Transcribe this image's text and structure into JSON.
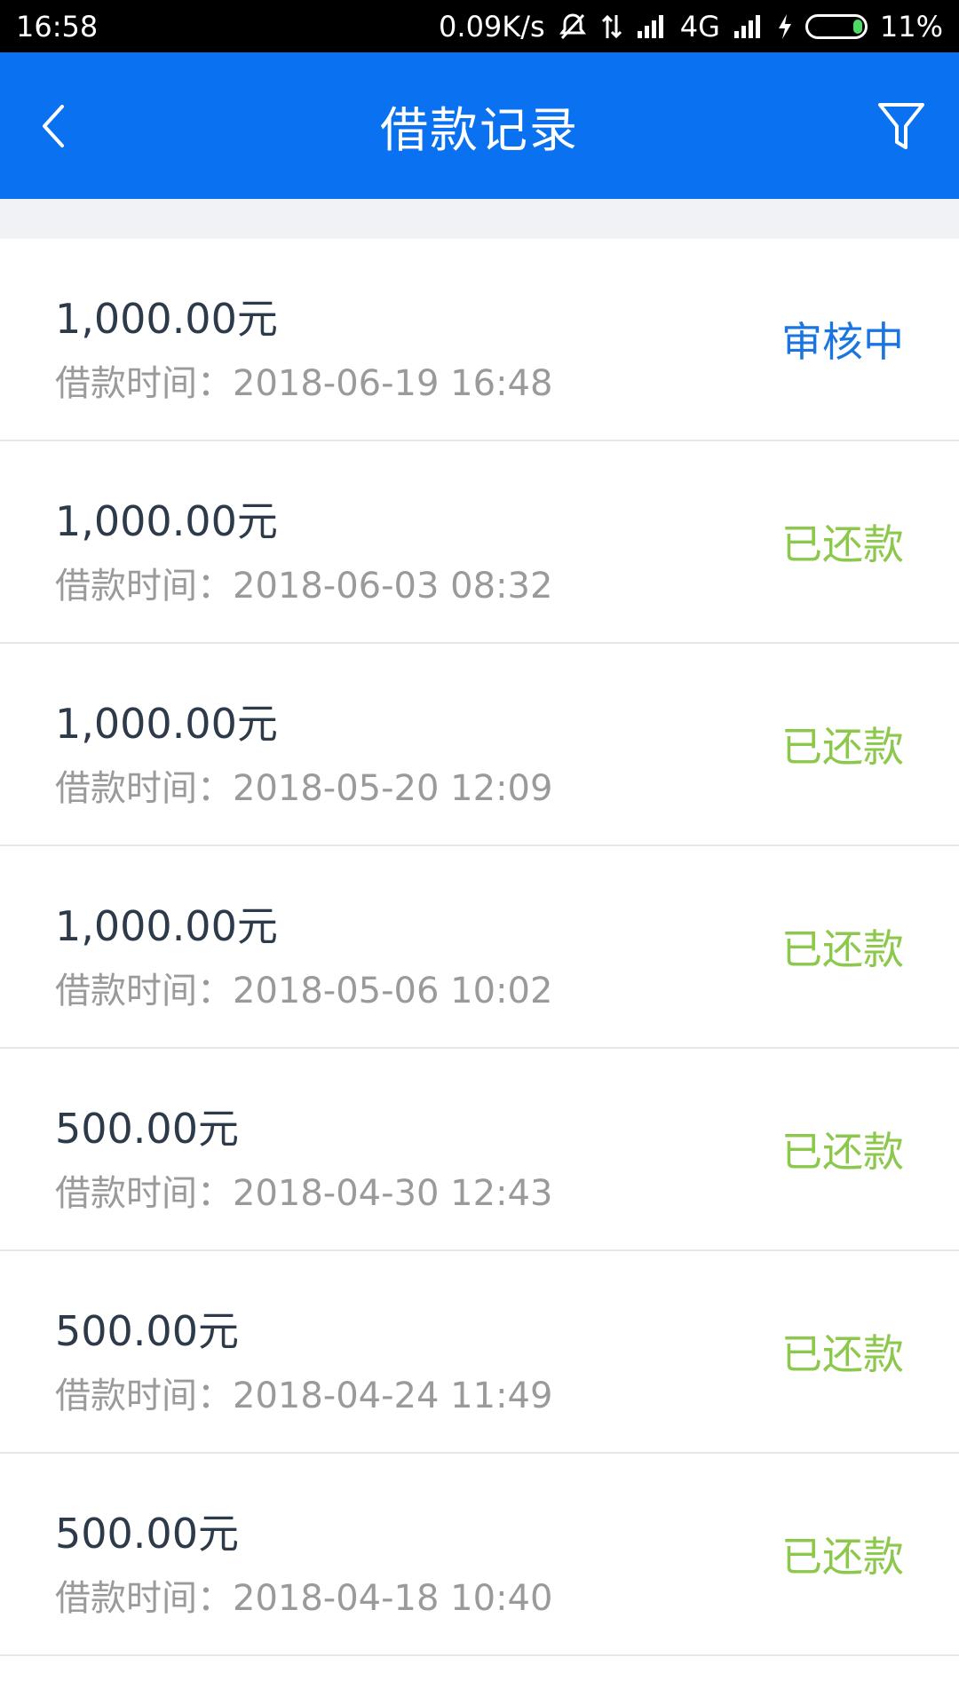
{
  "statusbar": {
    "time": "16:58",
    "speed": "0.09K/s",
    "network": "4G",
    "battery": "11%"
  },
  "header": {
    "title": "借款记录",
    "back_icon": "chevron-left-icon",
    "filter_icon": "filter-icon"
  },
  "colors": {
    "primary": "#0a72f0",
    "reviewing": "#1a75e0",
    "repaid": "#8cc84b"
  },
  "records": [
    {
      "amount": "1,000.00元",
      "time": "借款时间：2018-06-19 16:48",
      "status": "审核中",
      "state": "reviewing"
    },
    {
      "amount": "1,000.00元",
      "time": "借款时间：2018-06-03 08:32",
      "status": "已还款",
      "state": "repaid"
    },
    {
      "amount": "1,000.00元",
      "time": "借款时间：2018-05-20 12:09",
      "status": "已还款",
      "state": "repaid"
    },
    {
      "amount": "1,000.00元",
      "time": "借款时间：2018-05-06 10:02",
      "status": "已还款",
      "state": "repaid"
    },
    {
      "amount": "500.00元",
      "time": "借款时间：2018-04-30 12:43",
      "status": "已还款",
      "state": "repaid"
    },
    {
      "amount": "500.00元",
      "time": "借款时间：2018-04-24 11:49",
      "status": "已还款",
      "state": "repaid"
    },
    {
      "amount": "500.00元",
      "time": "借款时间：2018-04-18 10:40",
      "status": "已还款",
      "state": "repaid"
    }
  ]
}
